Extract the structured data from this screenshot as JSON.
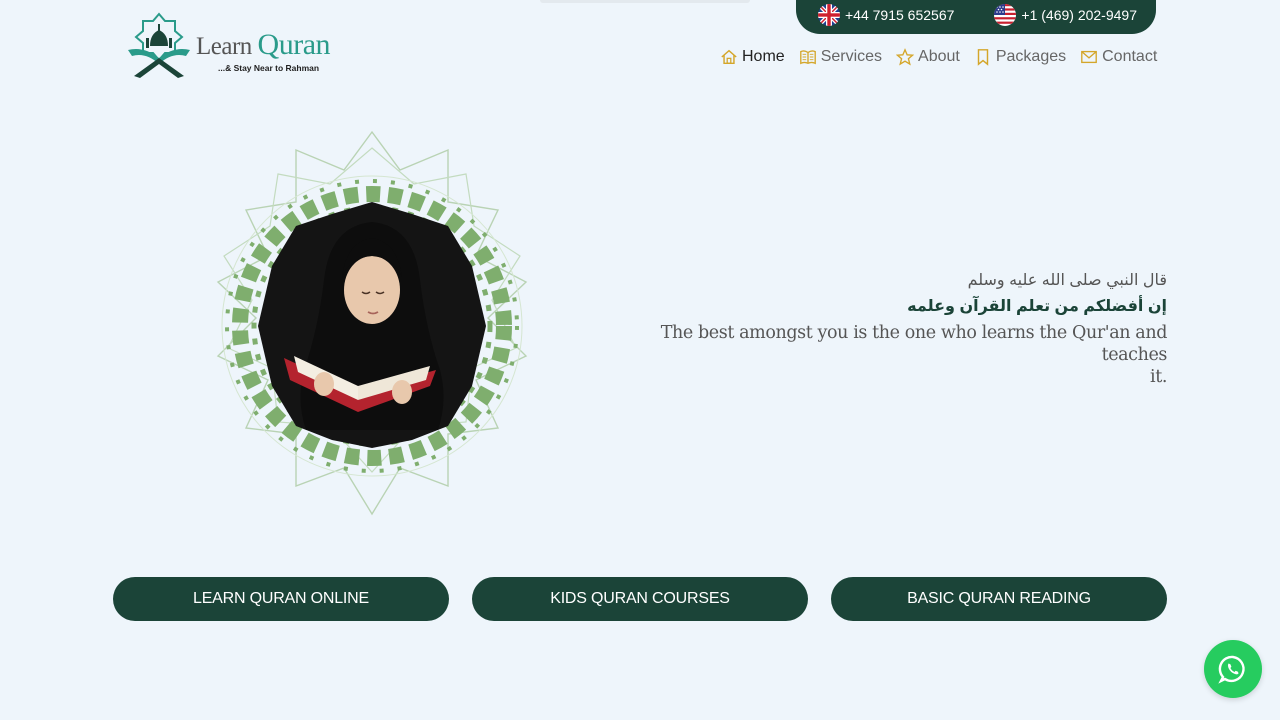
{
  "top_bar": {
    "phones": [
      {
        "flag_icon": "uk-flag-icon",
        "number": "+44 7915 652567"
      },
      {
        "flag_icon": "us-flag-icon",
        "number": "+1 (469) 202-9497"
      }
    ]
  },
  "logo": {
    "word1": "Learn",
    "word2": "Quran",
    "tagline": "...& Stay Near to Rahman"
  },
  "nav": {
    "items": [
      {
        "label": "Home",
        "icon": "home-icon",
        "active": true
      },
      {
        "label": "Services",
        "icon": "book-icon",
        "active": false
      },
      {
        "label": "About",
        "icon": "star-icon",
        "active": false
      },
      {
        "label": "Packages",
        "icon": "bookmark-icon",
        "active": false
      },
      {
        "label": "Contact",
        "icon": "envelope-icon",
        "active": false
      }
    ]
  },
  "hero": {
    "arabic_line1": "قال النبي صلى الله عليه وسلم",
    "arabic_line2": "إن أفضلكم من تعلم القرآن وعلمه",
    "english_line1": "The best amongst you is the one who learns the Qur'an and teaches",
    "english_line2": "it."
  },
  "courses": [
    "LEARN QURAN ONLINE",
    "KIDS QURAN COURSES",
    "BASIC QURAN READING"
  ],
  "colors": {
    "brand_dark_green": "#1b4438",
    "accent_teal": "#2a9b8a",
    "nav_icon_gold": "#d4a62a",
    "pattern_green": "#7fae6e",
    "whatsapp_green": "#26cc5f",
    "background": "#eef5fb"
  }
}
